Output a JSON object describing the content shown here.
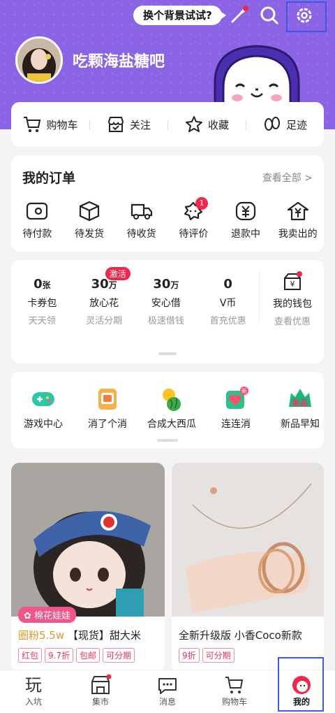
{
  "header": {
    "bg_button": "换个背景试试?",
    "username": "吃颗海盐糖吧"
  },
  "quick": [
    {
      "label": "购物车",
      "icon": "cart-icon"
    },
    {
      "label": "关注",
      "icon": "follow-shop-icon"
    },
    {
      "label": "收藏",
      "icon": "star-icon"
    },
    {
      "label": "足迹",
      "icon": "footprint-icon"
    }
  ],
  "orders": {
    "title": "我的订单",
    "view_all": "查看全部 >",
    "items": [
      {
        "label": "待付款",
        "icon": "wallet-icon"
      },
      {
        "label": "待发货",
        "icon": "package-icon"
      },
      {
        "label": "待收货",
        "icon": "truck-icon"
      },
      {
        "label": "待评价",
        "icon": "review-icon",
        "badge": "1"
      },
      {
        "label": "退款中",
        "icon": "refund-icon"
      },
      {
        "label": "我卖出的",
        "icon": "sold-icon"
      }
    ]
  },
  "wallet": {
    "items": [
      {
        "num": "0",
        "unit": "张",
        "label": "卡券包",
        "sub": "天天领"
      },
      {
        "num": "30",
        "unit": "万",
        "label": "放心花",
        "sub": "灵活分期",
        "badge": "激活"
      },
      {
        "num": "30",
        "unit": "万",
        "label": "安心借",
        "sub": "极速借钱"
      },
      {
        "num": "0",
        "unit": "",
        "label": "V币",
        "sub": "首充优惠"
      }
    ],
    "purse": {
      "label": "我的钱包",
      "sub": "查看优惠"
    }
  },
  "games": [
    {
      "label": "游戏中心"
    },
    {
      "label": "消了个消"
    },
    {
      "label": "合成大西瓜"
    },
    {
      "label": "连连消"
    },
    {
      "label": "新品早知"
    }
  ],
  "game_icon_text": {
    "new": "新",
    "newprod": "新品"
  },
  "products": [
    {
      "badge": "棉花娃娃",
      "price": "圈粉5.5w",
      "title": "【现货】甜大米",
      "tags": [
        "红包",
        "9.7折",
        "包邮",
        "可分期"
      ]
    },
    {
      "title": "全新升级版 小香Coco新款",
      "tags": [
        "9折",
        "可分期"
      ]
    }
  ],
  "tabs": [
    {
      "label": "入坑",
      "glyph": "玩"
    },
    {
      "label": "集市"
    },
    {
      "label": "消息"
    },
    {
      "label": "购物车"
    },
    {
      "label": "我的"
    }
  ],
  "colors": {
    "purple": "#8a64e4",
    "red": "#f0264b",
    "highlight": "#3a5be0"
  }
}
